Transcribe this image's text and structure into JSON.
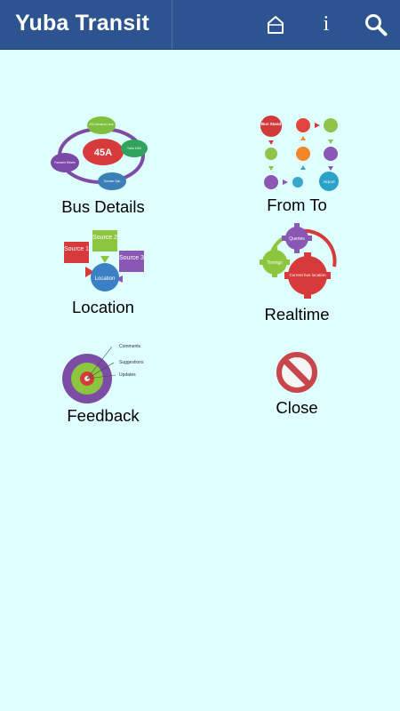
{
  "app_bar": {
    "title": "Yuba Transit",
    "home_icon": "home-icon",
    "info_icon": "info-icon",
    "info_glyph": "i",
    "search_icon": "search-icon",
    "background": "#2d5491"
  },
  "page": {
    "background": "#dffefe"
  },
  "menu": {
    "bus_details": {
      "label": "Bus Details",
      "icon": "bus-details-icon",
      "center_text": "45A",
      "node_texts": [
        "ATD Advance Lane",
        "Yuba 1000",
        "Sunrise Dpk",
        "Farmerie Wesee"
      ]
    },
    "from_to": {
      "label": "From To",
      "icon": "from-to-icon",
      "start_text": "Bus Stand",
      "end_text": "Airport"
    },
    "location": {
      "label": "Location",
      "icon": "location-icon",
      "sources": [
        "Source 1",
        "Source 2",
        "Source 3"
      ],
      "center_text": "Location"
    },
    "realtime": {
      "label": "Realtime",
      "icon": "realtime-gears-icon",
      "gears": [
        "Queries",
        "Timings",
        "Current bus location"
      ]
    },
    "feedback": {
      "label": "Feedback",
      "icon": "feedback-target-icon",
      "rings": [
        "Comments",
        "Suggestions",
        "Updates"
      ]
    },
    "close": {
      "label": "Close",
      "icon": "close-prohibited-icon"
    }
  }
}
